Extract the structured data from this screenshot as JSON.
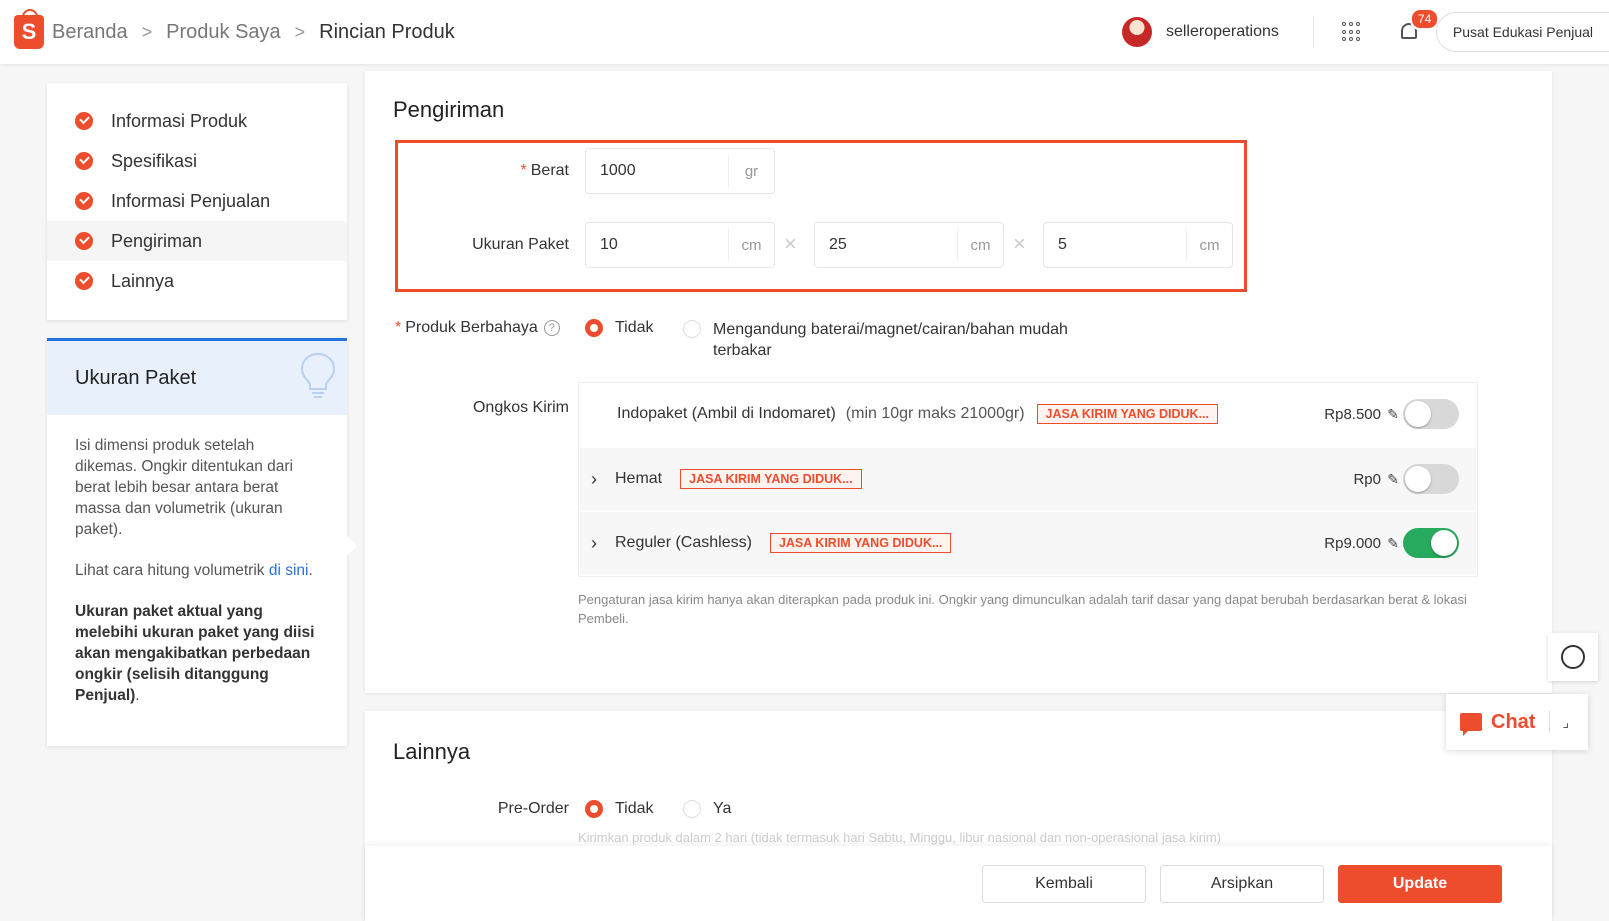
{
  "header": {
    "breadcrumbs": [
      "Beranda",
      "Produk Saya",
      "Rincian Produk"
    ],
    "logo_letter": "S",
    "username": "selleroperations",
    "notification_count": "74",
    "edu_label": "Pusat Edukasi Penjual"
  },
  "sidenav": {
    "items": [
      "Informasi Produk",
      "Spesifikasi",
      "Informasi Penjualan",
      "Pengiriman",
      "Lainnya"
    ]
  },
  "tip": {
    "title": "Ukuran Paket",
    "para1": "Isi dimensi produk setelah dikemas. Ongkir ditentukan dari berat lebih besar antara berat massa dan volumetrik (ukuran paket).",
    "para2_prefix": "Lihat cara hitung volumetrik ",
    "para2_link": "di sini",
    "para2_suffix": ".",
    "para3_bold": "Ukuran paket aktual yang melebihi ukuran paket yang diisi akan mengakibatkan perbedaan ongkir (selisih ditanggung Penjual)",
    "para3_suffix": "."
  },
  "shipping": {
    "title": "Pengiriman",
    "weight_label": "Berat",
    "weight_value": "1000",
    "weight_unit": "gr",
    "size_label": "Ukuran Paket",
    "dims": [
      {
        "value": "10",
        "unit": "cm"
      },
      {
        "value": "25",
        "unit": "cm"
      },
      {
        "value": "5",
        "unit": "cm"
      }
    ],
    "times": "×",
    "dangerous_label": "Produk Berbahaya",
    "help": "?",
    "dangerous_opt1": "Tidak",
    "dangerous_opt2_line1": "Mengandung baterai/magnet/cairan/bahan mudah",
    "dangerous_opt2_line2": "terbakar",
    "ongkir_label": "Ongkos Kirim",
    "rows": [
      {
        "chevron": "",
        "name": "Indopaket (Ambil di Indomaret)",
        "limit": "(min 10gr maks 21000gr)",
        "tag": "JASA KIRIM YANG DIDUK...",
        "price": "Rp8.500",
        "enabled": false
      },
      {
        "chevron": "›",
        "name": "Hemat",
        "limit": "",
        "tag": "JASA KIRIM YANG DIDUK...",
        "price": "Rp0",
        "enabled": false
      },
      {
        "chevron": "›",
        "name": "Reguler (Cashless)",
        "limit": "",
        "tag": "JASA KIRIM YANG DIDUK...",
        "price": "Rp9.000",
        "enabled": true
      }
    ],
    "pencil": "✎",
    "note": "Pengaturan jasa kirim hanya akan diterapkan pada produk ini. Ongkir yang dimunculkan adalah tarif dasar yang dapat berubah berdasarkan berat & lokasi Pembeli."
  },
  "others": {
    "title": "Lainnya",
    "preorder_label": "Pre-Order",
    "preorder_opt1": "Tidak",
    "preorder_opt2": "Ya",
    "preorder_note": "Kirimkan produk dalam 2 hari (tidak termasuk hari Sabtu, Minggu, libur nasional dan non-operasional jasa kirim)"
  },
  "footer": {
    "back": "Kembali",
    "archive": "Arsipkan",
    "update": "Update"
  },
  "chat": {
    "label": "Chat",
    "expand": "⌟"
  },
  "colors": {
    "accent": "#ee4d2d",
    "toggle_on": "#26aa5d",
    "link": "#2673dd"
  }
}
